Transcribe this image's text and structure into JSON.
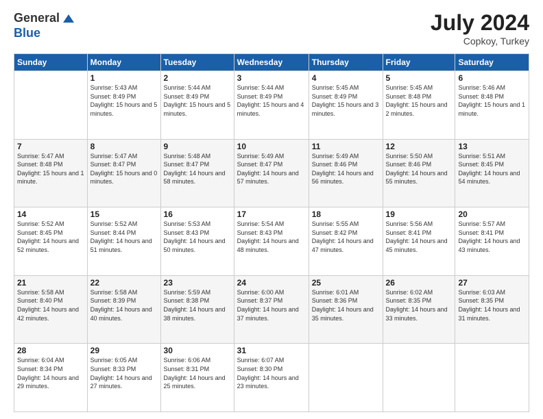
{
  "logo": {
    "general": "General",
    "blue": "Blue"
  },
  "title": {
    "month_year": "July 2024",
    "location": "Copkoy, Turkey"
  },
  "weekdays": [
    "Sunday",
    "Monday",
    "Tuesday",
    "Wednesday",
    "Thursday",
    "Friday",
    "Saturday"
  ],
  "weeks": [
    [
      {
        "day": "",
        "sunrise": "",
        "sunset": "",
        "daylight": ""
      },
      {
        "day": "1",
        "sunrise": "Sunrise: 5:43 AM",
        "sunset": "Sunset: 8:49 PM",
        "daylight": "Daylight: 15 hours and 5 minutes."
      },
      {
        "day": "2",
        "sunrise": "Sunrise: 5:44 AM",
        "sunset": "Sunset: 8:49 PM",
        "daylight": "Daylight: 15 hours and 5 minutes."
      },
      {
        "day": "3",
        "sunrise": "Sunrise: 5:44 AM",
        "sunset": "Sunset: 8:49 PM",
        "daylight": "Daylight: 15 hours and 4 minutes."
      },
      {
        "day": "4",
        "sunrise": "Sunrise: 5:45 AM",
        "sunset": "Sunset: 8:49 PM",
        "daylight": "Daylight: 15 hours and 3 minutes."
      },
      {
        "day": "5",
        "sunrise": "Sunrise: 5:45 AM",
        "sunset": "Sunset: 8:48 PM",
        "daylight": "Daylight: 15 hours and 2 minutes."
      },
      {
        "day": "6",
        "sunrise": "Sunrise: 5:46 AM",
        "sunset": "Sunset: 8:48 PM",
        "daylight": "Daylight: 15 hours and 1 minute."
      }
    ],
    [
      {
        "day": "7",
        "sunrise": "Sunrise: 5:47 AM",
        "sunset": "Sunset: 8:48 PM",
        "daylight": "Daylight: 15 hours and 1 minute."
      },
      {
        "day": "8",
        "sunrise": "Sunrise: 5:47 AM",
        "sunset": "Sunset: 8:47 PM",
        "daylight": "Daylight: 15 hours and 0 minutes."
      },
      {
        "day": "9",
        "sunrise": "Sunrise: 5:48 AM",
        "sunset": "Sunset: 8:47 PM",
        "daylight": "Daylight: 14 hours and 58 minutes."
      },
      {
        "day": "10",
        "sunrise": "Sunrise: 5:49 AM",
        "sunset": "Sunset: 8:47 PM",
        "daylight": "Daylight: 14 hours and 57 minutes."
      },
      {
        "day": "11",
        "sunrise": "Sunrise: 5:49 AM",
        "sunset": "Sunset: 8:46 PM",
        "daylight": "Daylight: 14 hours and 56 minutes."
      },
      {
        "day": "12",
        "sunrise": "Sunrise: 5:50 AM",
        "sunset": "Sunset: 8:46 PM",
        "daylight": "Daylight: 14 hours and 55 minutes."
      },
      {
        "day": "13",
        "sunrise": "Sunrise: 5:51 AM",
        "sunset": "Sunset: 8:45 PM",
        "daylight": "Daylight: 14 hours and 54 minutes."
      }
    ],
    [
      {
        "day": "14",
        "sunrise": "Sunrise: 5:52 AM",
        "sunset": "Sunset: 8:45 PM",
        "daylight": "Daylight: 14 hours and 52 minutes."
      },
      {
        "day": "15",
        "sunrise": "Sunrise: 5:52 AM",
        "sunset": "Sunset: 8:44 PM",
        "daylight": "Daylight: 14 hours and 51 minutes."
      },
      {
        "day": "16",
        "sunrise": "Sunrise: 5:53 AM",
        "sunset": "Sunset: 8:43 PM",
        "daylight": "Daylight: 14 hours and 50 minutes."
      },
      {
        "day": "17",
        "sunrise": "Sunrise: 5:54 AM",
        "sunset": "Sunset: 8:43 PM",
        "daylight": "Daylight: 14 hours and 48 minutes."
      },
      {
        "day": "18",
        "sunrise": "Sunrise: 5:55 AM",
        "sunset": "Sunset: 8:42 PM",
        "daylight": "Daylight: 14 hours and 47 minutes."
      },
      {
        "day": "19",
        "sunrise": "Sunrise: 5:56 AM",
        "sunset": "Sunset: 8:41 PM",
        "daylight": "Daylight: 14 hours and 45 minutes."
      },
      {
        "day": "20",
        "sunrise": "Sunrise: 5:57 AM",
        "sunset": "Sunset: 8:41 PM",
        "daylight": "Daylight: 14 hours and 43 minutes."
      }
    ],
    [
      {
        "day": "21",
        "sunrise": "Sunrise: 5:58 AM",
        "sunset": "Sunset: 8:40 PM",
        "daylight": "Daylight: 14 hours and 42 minutes."
      },
      {
        "day": "22",
        "sunrise": "Sunrise: 5:58 AM",
        "sunset": "Sunset: 8:39 PM",
        "daylight": "Daylight: 14 hours and 40 minutes."
      },
      {
        "day": "23",
        "sunrise": "Sunrise: 5:59 AM",
        "sunset": "Sunset: 8:38 PM",
        "daylight": "Daylight: 14 hours and 38 minutes."
      },
      {
        "day": "24",
        "sunrise": "Sunrise: 6:00 AM",
        "sunset": "Sunset: 8:37 PM",
        "daylight": "Daylight: 14 hours and 37 minutes."
      },
      {
        "day": "25",
        "sunrise": "Sunrise: 6:01 AM",
        "sunset": "Sunset: 8:36 PM",
        "daylight": "Daylight: 14 hours and 35 minutes."
      },
      {
        "day": "26",
        "sunrise": "Sunrise: 6:02 AM",
        "sunset": "Sunset: 8:35 PM",
        "daylight": "Daylight: 14 hours and 33 minutes."
      },
      {
        "day": "27",
        "sunrise": "Sunrise: 6:03 AM",
        "sunset": "Sunset: 8:35 PM",
        "daylight": "Daylight: 14 hours and 31 minutes."
      }
    ],
    [
      {
        "day": "28",
        "sunrise": "Sunrise: 6:04 AM",
        "sunset": "Sunset: 8:34 PM",
        "daylight": "Daylight: 14 hours and 29 minutes."
      },
      {
        "day": "29",
        "sunrise": "Sunrise: 6:05 AM",
        "sunset": "Sunset: 8:33 PM",
        "daylight": "Daylight: 14 hours and 27 minutes."
      },
      {
        "day": "30",
        "sunrise": "Sunrise: 6:06 AM",
        "sunset": "Sunset: 8:31 PM",
        "daylight": "Daylight: 14 hours and 25 minutes."
      },
      {
        "day": "31",
        "sunrise": "Sunrise: 6:07 AM",
        "sunset": "Sunset: 8:30 PM",
        "daylight": "Daylight: 14 hours and 23 minutes."
      },
      {
        "day": "",
        "sunrise": "",
        "sunset": "",
        "daylight": ""
      },
      {
        "day": "",
        "sunrise": "",
        "sunset": "",
        "daylight": ""
      },
      {
        "day": "",
        "sunrise": "",
        "sunset": "",
        "daylight": ""
      }
    ]
  ]
}
